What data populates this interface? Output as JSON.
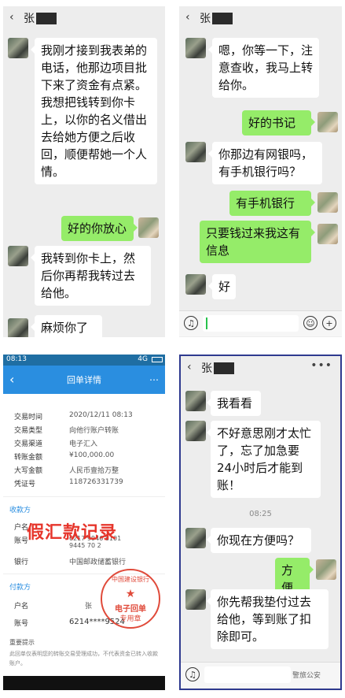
{
  "panel1": {
    "contact": "张",
    "messages": [
      {
        "from": "in",
        "text": "我刚才接到我表弟的电话，他那边项目批下来了资金有点紧。我想把钱转到你卡上，以你的名义借出去给她方便之后收回，顺便帮她一个人情。"
      },
      {
        "from": "out",
        "text": "好的你放心"
      },
      {
        "from": "in",
        "text": "我转到你卡上，然后你再帮我转过去给他。"
      },
      {
        "from": "in",
        "text": "麻烦你了"
      }
    ]
  },
  "panel2": {
    "contact": "张",
    "messages": [
      {
        "from": "in",
        "text": "嗯，你等一下，注意查收，我马上转给你。"
      },
      {
        "from": "out",
        "text": "好的书记"
      },
      {
        "from": "in",
        "text": "你那边有网银吗，有手机银行吗？"
      },
      {
        "from": "out",
        "text": "有手机银行"
      },
      {
        "from": "out",
        "text": "只要钱过来我这有信息"
      },
      {
        "from": "in",
        "text": "好"
      }
    ]
  },
  "panel3": {
    "status_time": "08:13",
    "status_right": "4G",
    "title": "回单详情",
    "fields": [
      {
        "k": "交易时间",
        "v": "2020/12/11 08:13"
      },
      {
        "k": "交易类型",
        "v": "向他行账户转账"
      },
      {
        "k": "交易渠道",
        "v": "电子汇入"
      },
      {
        "k": "转账金额",
        "v": "¥100,000.00"
      },
      {
        "k": "大写金额",
        "v": "人民币壹拾万整"
      },
      {
        "k": "凭证号",
        "v": "118726331739"
      }
    ],
    "payee_title": "收款方",
    "payee": [
      {
        "k": "户名",
        "v": ""
      },
      {
        "k": "账号",
        "v": "6217 9946 8101 9445 70 2"
      },
      {
        "k": "银行",
        "v": "中国邮政储蓄银行"
      }
    ],
    "payer_title": "付款方",
    "payer": [
      {
        "k": "户名",
        "v": "张"
      },
      {
        "k": "账号",
        "v": "6214****9524"
      }
    ],
    "fake_label": "假汇款记录",
    "seal": {
      "ring": "中国建设银行",
      "star": "★",
      "line1": "电子回单",
      "line2": "专用章"
    },
    "tips_title": "重要提示",
    "tips_text": "此回单仅表明您的转账交易受理成功，不代表资金已转入收款账户。"
  },
  "panel4": {
    "contact": "张",
    "messages": [
      {
        "from": "in",
        "text": "我看看"
      },
      {
        "from": "in",
        "text": "不好意思刚才太忙了，忘了加急要24小时后才能到账！"
      },
      {
        "from": "in",
        "text": "你现在方便吗？"
      },
      {
        "from": "out",
        "text": "方便"
      },
      {
        "from": "in",
        "text": "你先帮我垫付过去给他，等到账了扣除即可。"
      }
    ],
    "timestamp": "08:25",
    "watermark": "警旅公安"
  },
  "icons": [
    "back-icon",
    "more-icon",
    "voice-icon",
    "emoji-icon",
    "plus-icon",
    "seal-icon"
  ]
}
